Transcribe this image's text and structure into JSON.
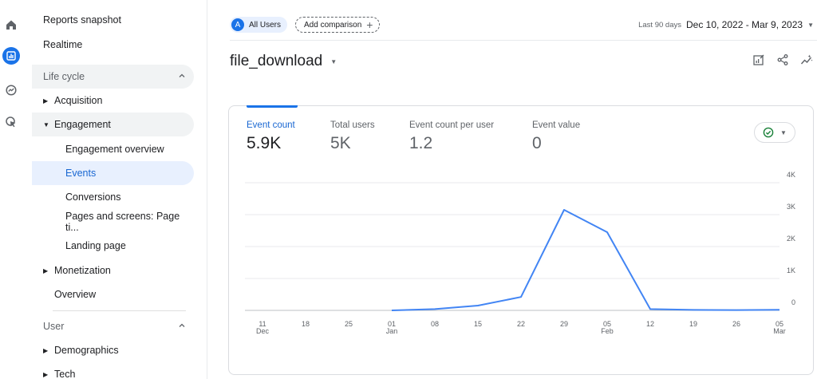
{
  "nav": {
    "reports_snapshot": "Reports snapshot",
    "realtime": "Realtime",
    "lifecycle_section": "Life cycle",
    "acquisition": "Acquisition",
    "engagement": "Engagement",
    "engagement_overview": "Engagement overview",
    "events": "Events",
    "conversions": "Conversions",
    "pages_and_screens": "Pages and screens: Page ti...",
    "landing_page": "Landing page",
    "monetization": "Monetization",
    "overview": "Overview",
    "user_section": "User",
    "demographics": "Demographics",
    "tech": "Tech"
  },
  "header": {
    "all_users_badge": "A",
    "all_users": "All Users",
    "add_comparison": "Add comparison",
    "date_label": "Last 90 days",
    "date_range": "Dec 10, 2022 - Mar 9, 2023"
  },
  "page": {
    "title": "file_download"
  },
  "metrics": [
    {
      "label": "Event count",
      "value": "5.9K"
    },
    {
      "label": "Total users",
      "value": "5K"
    },
    {
      "label": "Event count per user",
      "value": "1.2"
    },
    {
      "label": "Event value",
      "value": "0"
    }
  ],
  "colors": {
    "accent": "#1a73e8",
    "line": "#4285f4",
    "check": "#188038"
  },
  "chart_data": {
    "type": "line",
    "title": "",
    "xlabel": "",
    "ylabel": "",
    "x": [
      "Jan 01",
      "Jan 08",
      "Jan 15",
      "Jan 22",
      "Jan 29",
      "Feb 05",
      "Feb 12",
      "Feb 19",
      "Feb 26",
      "Mar 05"
    ],
    "series": [
      {
        "values": [
          0,
          40,
          150,
          420,
          3150,
          2450,
          40,
          15,
          10,
          20
        ]
      }
    ],
    "ylim": [
      0,
      4000
    ],
    "y_ticks": [
      "0",
      "1K",
      "2K",
      "3K",
      "4K"
    ],
    "x_tick_labels": [
      {
        "day": "11",
        "month": "Dec"
      },
      {
        "day": "18",
        "month": ""
      },
      {
        "day": "25",
        "month": ""
      },
      {
        "day": "01",
        "month": "Jan"
      },
      {
        "day": "08",
        "month": ""
      },
      {
        "day": "15",
        "month": ""
      },
      {
        "day": "22",
        "month": ""
      },
      {
        "day": "29",
        "month": ""
      },
      {
        "day": "05",
        "month": "Feb"
      },
      {
        "day": "12",
        "month": ""
      },
      {
        "day": "19",
        "month": ""
      },
      {
        "day": "26",
        "month": ""
      },
      {
        "day": "05",
        "month": "Mar"
      }
    ],
    "grid": true,
    "y_axis_side": "right"
  }
}
